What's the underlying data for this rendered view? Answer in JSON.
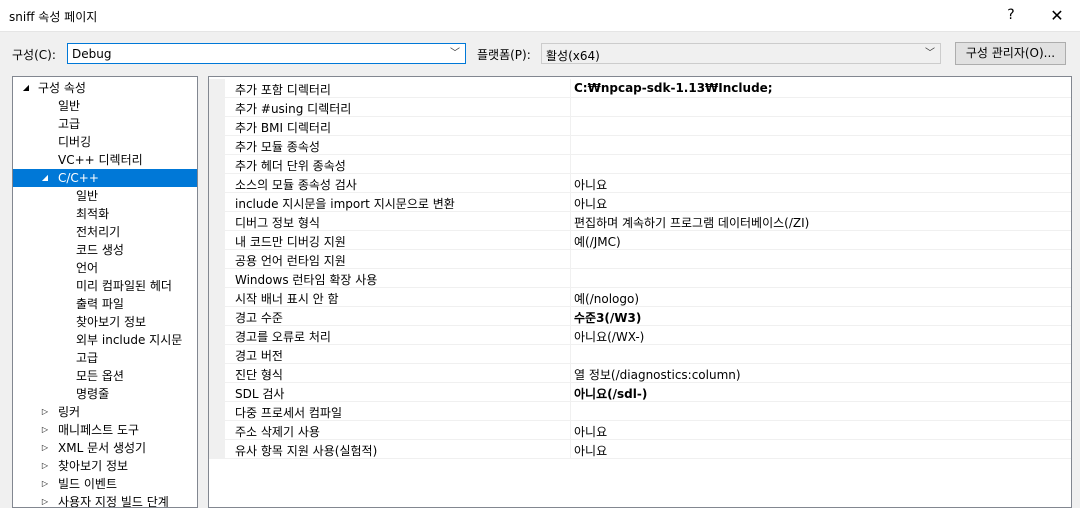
{
  "window": {
    "title": "sniff 속성 페이지",
    "help_glyph": "?",
    "close_glyph": "✕"
  },
  "toolbar": {
    "config_label": "구성(C):",
    "config_value": "Debug",
    "platform_label": "플랫폼(P):",
    "platform_value": "활성(x64)",
    "manager_button": "구성 관리자(O)..."
  },
  "tree": {
    "items": [
      {
        "label": "구성 속성",
        "level": 0,
        "expander": "◢"
      },
      {
        "label": "일반",
        "level": 1
      },
      {
        "label": "고급",
        "level": 1
      },
      {
        "label": "디버깅",
        "level": 1
      },
      {
        "label": "VC++ 디렉터리",
        "level": 1
      },
      {
        "label": "C/C++",
        "level": 1,
        "expander": "◢",
        "selected": true
      },
      {
        "label": "일반",
        "level": 2
      },
      {
        "label": "최적화",
        "level": 2
      },
      {
        "label": "전처리기",
        "level": 2
      },
      {
        "label": "코드 생성",
        "level": 2
      },
      {
        "label": "언어",
        "level": 2
      },
      {
        "label": "미리 컴파일된 헤더",
        "level": 2
      },
      {
        "label": "출력 파일",
        "level": 2
      },
      {
        "label": "찾아보기 정보",
        "level": 2
      },
      {
        "label": "외부 include 지시문",
        "level": 2
      },
      {
        "label": "고급",
        "level": 2
      },
      {
        "label": "모든 옵션",
        "level": 2
      },
      {
        "label": "명령줄",
        "level": 2
      },
      {
        "label": "링커",
        "level": 1,
        "expander": "▷"
      },
      {
        "label": "매니페스트 도구",
        "level": 1,
        "expander": "▷"
      },
      {
        "label": "XML 문서 생성기",
        "level": 1,
        "expander": "▷"
      },
      {
        "label": "찾아보기 정보",
        "level": 1,
        "expander": "▷"
      },
      {
        "label": "빌드 이벤트",
        "level": 1,
        "expander": "▷"
      },
      {
        "label": "사용자 지정 빌드 단계",
        "level": 1,
        "expander": "▷"
      }
    ]
  },
  "properties": [
    {
      "name": "추가 포함 디렉터리",
      "value": "C:₩npcap-sdk-1.13₩Include;",
      "bold": true
    },
    {
      "name": "추가 #using 디렉터리",
      "value": ""
    },
    {
      "name": "추가 BMI 디렉터리",
      "value": ""
    },
    {
      "name": "추가 모듈 종속성",
      "value": ""
    },
    {
      "name": "추가 헤더 단위 종속성",
      "value": ""
    },
    {
      "name": "소스의 모듈 종속성 검사",
      "value": "아니요"
    },
    {
      "name": "include 지시문을 import 지시문으로 변환",
      "value": "아니요"
    },
    {
      "name": "디버그 정보 형식",
      "value": "편집하며 계속하기 프로그램 데이터베이스(/ZI)"
    },
    {
      "name": "내 코드만 디버깅 지원",
      "value": "예(/JMC)"
    },
    {
      "name": "공용 언어 런타임 지원",
      "value": ""
    },
    {
      "name": "Windows 런타임 확장 사용",
      "value": ""
    },
    {
      "name": "시작 배너 표시 안 함",
      "value": "예(/nologo)"
    },
    {
      "name": "경고 수준",
      "value": "수준3(/W3)",
      "bold": true
    },
    {
      "name": "경고를 오류로 처리",
      "value": "아니요(/WX-)"
    },
    {
      "name": "경고 버전",
      "value": ""
    },
    {
      "name": "진단 형식",
      "value": "열 정보(/diagnostics:column)"
    },
    {
      "name": "SDL 검사",
      "value": "아니요(/sdl-)",
      "bold": true
    },
    {
      "name": "다중 프로세서 컴파일",
      "value": ""
    },
    {
      "name": "주소 삭제기 사용",
      "value": "아니요"
    },
    {
      "name": "유사 항목 지원 사용(실험적)",
      "value": "아니요"
    }
  ],
  "colors": {
    "selection": "#0078d7",
    "focus_border": "#0078d7",
    "panel_background": "#f0f0f0"
  }
}
